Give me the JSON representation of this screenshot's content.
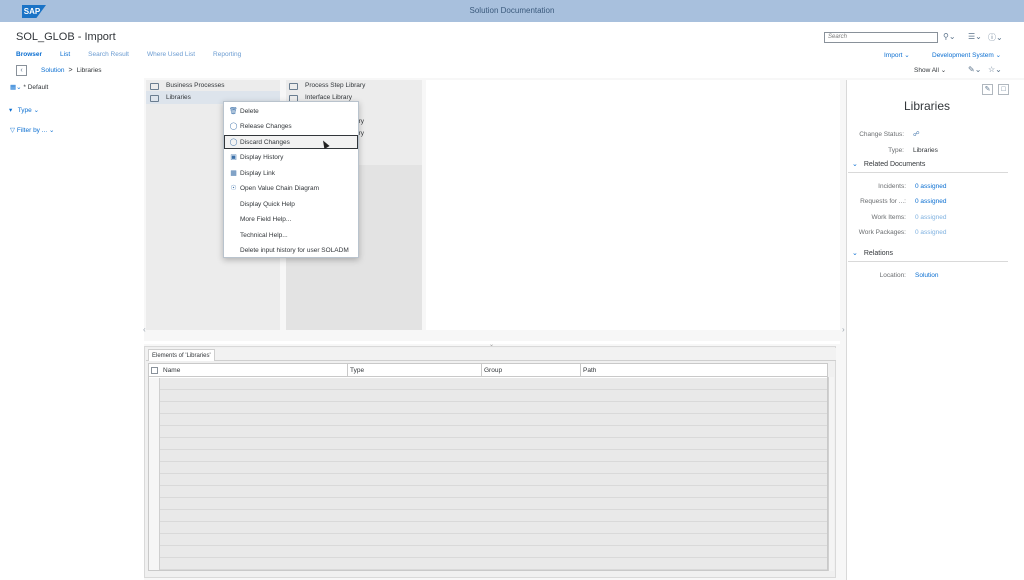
{
  "shell": {
    "logo": "SAP",
    "title": "Solution Documentation"
  },
  "header": {
    "page_title": "SOL_GLOB - Import",
    "tabs": [
      {
        "label": "Browser"
      },
      {
        "label": "List"
      },
      {
        "label": "Search Result"
      },
      {
        "label": "Where Used List"
      },
      {
        "label": "Reporting"
      }
    ],
    "search_placeholder": "Search",
    "import_label": "Import",
    "dev_system_label": "Development System",
    "show_all_label": "Show All",
    "breadcrumb": {
      "root": "Solution",
      "separator": ">",
      "current": "Libraries"
    }
  },
  "left_pane": {
    "view_label": "* Default",
    "type_label": "Type",
    "filter_label": "Filter by ..."
  },
  "column1": {
    "items": [
      {
        "label": "Business Processes"
      },
      {
        "label": "Libraries"
      }
    ]
  },
  "column2": {
    "items": [
      {
        "label": "Process Step Library"
      },
      {
        "label": "Interface Library"
      },
      {
        "label": "ary"
      },
      {
        "label": "ary"
      }
    ]
  },
  "context_menu": {
    "items": [
      {
        "label": "Delete",
        "icon": "trash-icon"
      },
      {
        "label": "Release Changes",
        "icon": "release-icon"
      },
      {
        "label": "Discard Changes",
        "icon": "discard-icon"
      },
      {
        "label": "Display History",
        "icon": "history-icon"
      },
      {
        "label": "Display Link",
        "icon": "link-icon"
      },
      {
        "label": "Open Value Chain Diagram",
        "icon": "diagram-icon"
      },
      {
        "label": "Display Quick Help",
        "icon": ""
      },
      {
        "label": "More Field Help...",
        "icon": ""
      },
      {
        "label": "Technical Help...",
        "icon": ""
      },
      {
        "label": "Delete input history for user SOLADM",
        "icon": ""
      }
    ]
  },
  "elements_table": {
    "tab_label": "Elements of 'Libraries'",
    "columns": [
      "Name",
      "Type",
      "Group",
      "Path"
    ]
  },
  "detail": {
    "title": "Libraries",
    "change_status_label": "Change Status:",
    "type_label": "Type:",
    "type_value": "Libraries",
    "related_documents": {
      "header": "Related Documents",
      "rows": [
        {
          "label": "Incidents:",
          "value": "0 assigned"
        },
        {
          "label": "Requests for ...:",
          "value": "0 assigned"
        },
        {
          "label": "Work Items:",
          "value": "0 assigned"
        },
        {
          "label": "Work Packages:",
          "value": "0 assigned"
        }
      ]
    },
    "relations": {
      "header": "Relations",
      "location_label": "Location:",
      "location_value": "Solution"
    }
  }
}
